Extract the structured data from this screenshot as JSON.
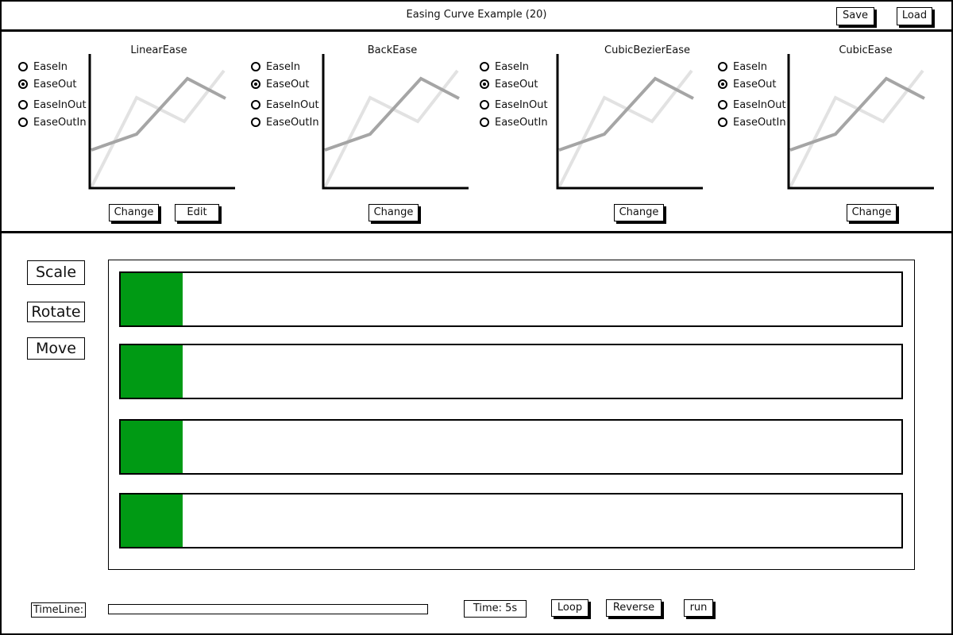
{
  "window": {
    "title": "Easing Curve Example (20)"
  },
  "toolbar": {
    "save_label": "Save",
    "load_label": "Load"
  },
  "colors": {
    "block": "#009a14",
    "curve_dark": "#a5a5a5",
    "curve_light": "#e2e2e2"
  },
  "panels": [
    {
      "title": "LinearEase",
      "options": [
        "EaseIn",
        "EaseOut",
        "EaseInOut",
        "EaseOutIn"
      ],
      "selected": "EaseOut",
      "change_label": "Change",
      "edit_label": "Edit"
    },
    {
      "title": "BackEase",
      "options": [
        "EaseIn",
        "EaseOut",
        "EaseInOut",
        "EaseOutIn"
      ],
      "selected": "EaseOut",
      "change_label": "Change"
    },
    {
      "title": "CubicBezierEase",
      "options": [
        "EaseIn",
        "EaseOut",
        "EaseInOut",
        "EaseOutIn"
      ],
      "selected": "EaseOut",
      "change_label": "Change"
    },
    {
      "title": "CubicEase",
      "options": [
        "EaseIn",
        "EaseOut",
        "EaseInOut",
        "EaseOutIn"
      ],
      "selected": "EaseOut",
      "change_label": "Change"
    }
  ],
  "actions": {
    "scale_label": "Scale",
    "rotate_label": "Rotate",
    "move_label": "Move"
  },
  "tracks": [
    {
      "progress": 0
    },
    {
      "progress": 0
    },
    {
      "progress": 0
    },
    {
      "progress": 0
    }
  ],
  "bottom": {
    "timeline_label": "TimeLine:",
    "timeline_progress": 0,
    "time_label": "Time: 5s",
    "loop_label": "Loop",
    "reverse_label": "Reverse",
    "run_label": "run"
  }
}
